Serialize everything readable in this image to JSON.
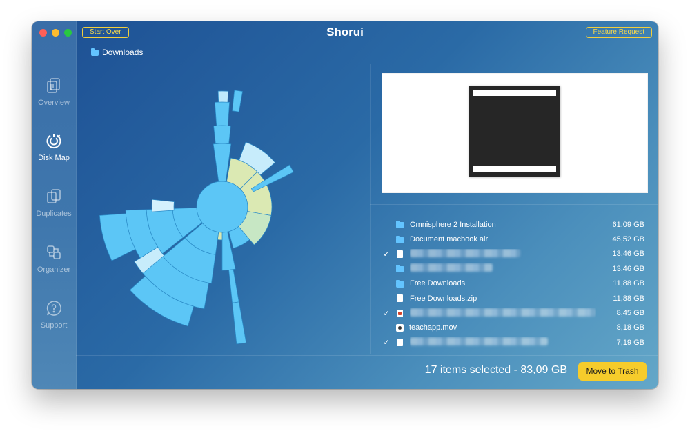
{
  "window": {
    "title": "Shorui",
    "start_over_label": "Start Over",
    "feature_request_label": "Feature Request"
  },
  "sidebar": {
    "items": [
      {
        "label": "Overview",
        "icon": "overview-icon",
        "active": false
      },
      {
        "label": "Disk Map",
        "icon": "disk-map-icon",
        "active": true
      },
      {
        "label": "Duplicates",
        "icon": "duplicates-icon",
        "active": false
      },
      {
        "label": "Organizer",
        "icon": "organizer-icon",
        "active": false
      },
      {
        "label": "Support",
        "icon": "support-icon",
        "active": false
      }
    ]
  },
  "breadcrumb": {
    "folder": "Downloads"
  },
  "files": [
    {
      "name": "Omnisphere 2 Installation",
      "size": "61,09 GB",
      "checked": false,
      "icon": "folder-icon"
    },
    {
      "name": "Document macbook air",
      "size": "45,52 GB",
      "checked": false,
      "icon": "folder-icon"
    },
    {
      "name": "",
      "size": "13,46 GB",
      "checked": true,
      "icon": "document-icon",
      "blurred": true
    },
    {
      "name": "",
      "size": "13,46 GB",
      "checked": false,
      "icon": "folder-icon",
      "blurred": true
    },
    {
      "name": "Free Downloads",
      "size": "11,88 GB",
      "checked": false,
      "icon": "folder-icon"
    },
    {
      "name": "Free Downloads.zip",
      "size": "11,88 GB",
      "checked": false,
      "icon": "zip-icon"
    },
    {
      "name": "",
      "size": "8,45 GB",
      "checked": true,
      "icon": "pdf-icon",
      "blurred": true
    },
    {
      "name": "teachapp.mov",
      "size": "8,18 GB",
      "checked": false,
      "icon": "movie-icon"
    },
    {
      "name": "",
      "size": "7,19 GB",
      "checked": true,
      "icon": "document-icon",
      "blurred": true
    }
  ],
  "footer": {
    "summary": "17 items selected - 83,09 GB",
    "trash_label": "Move to Trash"
  },
  "colors": {
    "accent_yellow": "#f6cc2b",
    "folder_blue": "#63c4ff",
    "map_blue": "#5cc6f6",
    "map_green": "#dbe9b3"
  }
}
